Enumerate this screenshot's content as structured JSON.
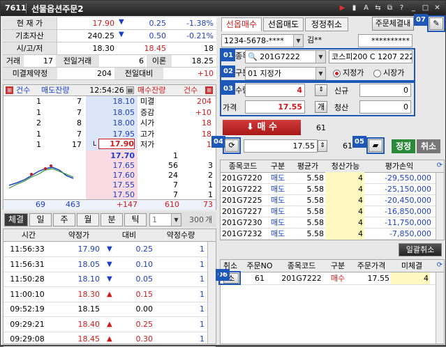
{
  "title": {
    "code": "7611",
    "name": "선물옵션주문2"
  },
  "quote": {
    "r1": {
      "label": "현 재 가",
      "price": "17.90",
      "chg": "0.25",
      "pct": "-1.38%"
    },
    "r2": {
      "label": "기초자산",
      "price": "240.25",
      "chg": "0.50",
      "pct": "-0.21%"
    },
    "r3": {
      "label": "시/고/저",
      "open": "18.30",
      "high": "18.45",
      "low": "18"
    },
    "r4": {
      "l1": "거래",
      "v1": "17",
      "l2": "전일거래",
      "v2": "6",
      "l3": "이론",
      "v3": "18.25"
    },
    "r5": {
      "l1": "미결제약정",
      "v1": "204",
      "l2": "전일대비",
      "v2": "+10"
    }
  },
  "orderbook": {
    "h": {
      "cnt": "건수",
      "askrem": "매도잔량",
      "time": "12:54:26",
      "bidrem": "매수잔량",
      "bcnt": "건수"
    },
    "asks": [
      {
        "c": "1",
        "q": "7",
        "p": "18.10",
        "k": "미결",
        "v": "204"
      },
      {
        "c": "1",
        "q": "7",
        "p": "18.05",
        "k": "증감",
        "v": "+10"
      },
      {
        "c": "2",
        "q": "8",
        "p": "18.00",
        "k": "시가",
        "v": "18"
      },
      {
        "c": "1",
        "q": "7",
        "p": "17.95",
        "k": "고가",
        "v": "18"
      },
      {
        "c": "1",
        "q": "17",
        "m": "L",
        "p": "17.90",
        "k": "저가",
        "v": "1"
      }
    ],
    "bids": [
      {
        "p": "17.70",
        "q": "1",
        "c": ""
      },
      {
        "p": "17.65",
        "q": "56",
        "c": "3"
      },
      {
        "p": "17.60",
        "q": "24",
        "c": "2"
      },
      {
        "p": "17.55",
        "q": "7",
        "c": "1"
      },
      {
        "p": "17.50",
        "q": "7",
        "c": "1"
      }
    ],
    "sum": {
      "a": "69",
      "b": "463",
      "d": "+147",
      "e": "610",
      "f": "73"
    }
  },
  "ltabs": [
    "체결",
    "일",
    "주",
    "월",
    "분",
    "틱"
  ],
  "ltabctrl": {
    "sel": "1",
    "ph": "300",
    "unit": "개"
  },
  "trades": {
    "hdr": [
      "시간",
      "약정가",
      "대비",
      "약정수량"
    ],
    "rows": [
      {
        "t": "11:56:33",
        "p": "17.90",
        "d": "0.25",
        "dir": "down",
        "q": "1"
      },
      {
        "t": "11:56:31",
        "p": "18.05",
        "d": "0.10",
        "dir": "down",
        "q": "1"
      },
      {
        "t": "11:50:28",
        "p": "18.10",
        "d": "0.05",
        "dir": "down",
        "q": "1"
      },
      {
        "t": "11:00:10",
        "p": "18.30",
        "d": "0.15",
        "dir": "up",
        "q": "1"
      },
      {
        "t": "09:52:19",
        "p": "18.15",
        "d": "0.00",
        "dir": "flat",
        "q": "1"
      },
      {
        "t": "09:29:21",
        "p": "18.40",
        "d": "0.25",
        "dir": "up",
        "q": "1"
      },
      {
        "t": "09:29:08",
        "p": "18.45",
        "d": "0.30",
        "dir": "up",
        "q": "1"
      }
    ]
  },
  "rtabs": [
    "선옵매수",
    "선옵매도",
    "정정취소"
  ],
  "rtab4": "주문체결내",
  "acct": {
    "no": "1234-5678-****",
    "name": "김**",
    "pw": "**********"
  },
  "form": {
    "code_label": "종목",
    "code": "201G7222",
    "desc": "코스피200 C 1207 222",
    "type_label": "구분",
    "type": "01 지정가",
    "r1": "지정가",
    "r2": "시장가",
    "qty_label": "수량",
    "qty": "4",
    "new_label": "신규",
    "new_v": "0",
    "price_label": "가격",
    "price": "17.55",
    "pbtn": "개",
    "close_label": "청산",
    "close_v": "0"
  },
  "buy": {
    "label": "매 수",
    "count": "61"
  },
  "modify": {
    "price": "17.55",
    "count": "61",
    "fix": "정정",
    "cancel": "취소"
  },
  "badges": [
    "01",
    "02",
    "03",
    "04",
    "05",
    "06",
    "07"
  ],
  "pos": {
    "hdr": [
      "종목코드",
      "구분",
      "평균가",
      "청산가능",
      "평가손익"
    ],
    "rows": [
      {
        "c": "201G7220",
        "g": "매도",
        "a": "5.58",
        "q": "4",
        "e": "-29,550,000"
      },
      {
        "c": "201G7222",
        "g": "매도",
        "a": "5.58",
        "q": "4",
        "e": "-25,150,000"
      },
      {
        "c": "201G7225",
        "g": "매도",
        "a": "5.58",
        "q": "4",
        "e": "-20,450,000"
      },
      {
        "c": "201G7227",
        "g": "매도",
        "a": "5.58",
        "q": "4",
        "e": "-16,850,000"
      },
      {
        "c": "201G7230",
        "g": "매도",
        "a": "5.58",
        "q": "4",
        "e": "-11,750,000"
      },
      {
        "c": "201G7232",
        "g": "매도",
        "a": "5.58",
        "q": "4",
        "e": "-7,850,000"
      }
    ]
  },
  "bulk": "일괄취소",
  "orders": {
    "hdr": [
      "취소",
      "주문NO",
      "종목코드",
      "구분",
      "주문가격",
      "미체결"
    ],
    "rows": [
      {
        "x": "소",
        "n": "61",
        "c": "201G7222",
        "g": "매수",
        "p": "17.55",
        "u": "4"
      }
    ]
  },
  "colors": {
    "up": "#d41818",
    "down": "#1a3ec8",
    "badge": "#1d57b8",
    "ask": "#dbe6f8",
    "bid": "#f8dbe3"
  }
}
